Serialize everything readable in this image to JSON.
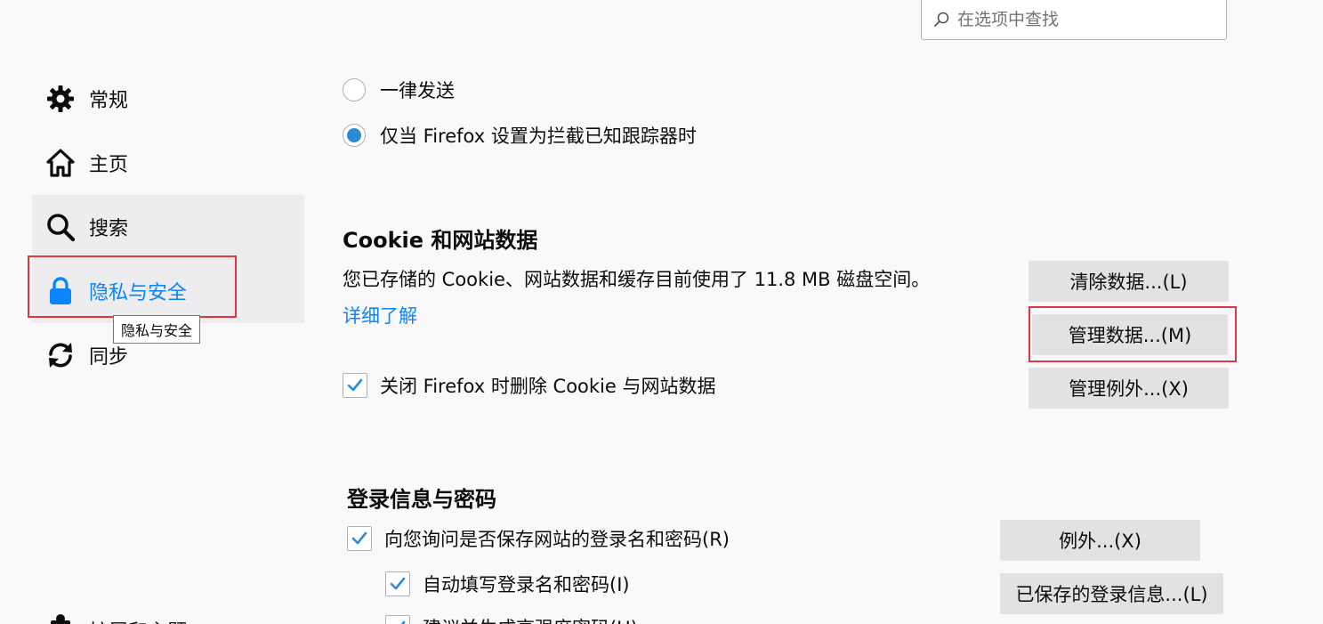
{
  "search": {
    "placeholder": "在选项中查找",
    "value": ""
  },
  "sidebar": {
    "items": [
      {
        "label": "常规",
        "icon": "gear-icon"
      },
      {
        "label": "主页",
        "icon": "home-icon"
      },
      {
        "label": "搜索",
        "icon": "search-icon",
        "state": "hovered"
      },
      {
        "label": "隐私与安全",
        "icon": "lock-icon",
        "state": "selected"
      },
      {
        "label": "同步",
        "icon": "sync-icon"
      },
      {
        "label": "扩展和主题",
        "icon": "puzzle-icon"
      }
    ],
    "tooltip": "隐私与安全"
  },
  "dnt": {
    "option_always": "一律发送",
    "option_tracking": "仅当 Firefox 设置为拦截已知跟踪器时",
    "selected": "option_tracking"
  },
  "cookies": {
    "title": "Cookie 和网站数据",
    "description": "您已存储的 Cookie、网站数据和缓存目前使用了 11.8 MB 磁盘空间。",
    "learn_more": "详细了解",
    "delete_on_close": {
      "label": "关闭 Firefox 时删除 Cookie 与网站数据",
      "checked": true
    },
    "buttons": {
      "clear": "清除数据...(L)",
      "manage": "管理数据...(M)",
      "exceptions": "管理例外...(X)"
    }
  },
  "logins": {
    "title": "登录信息与密码",
    "ask_save": {
      "label": "向您询问是否保存网站的登录名和密码(R)",
      "checked": true
    },
    "autofill": {
      "label": "自动填写登录名和密码(I)",
      "checked": true
    },
    "suggest": {
      "label": "建议并生成高强度密码(U)",
      "checked": true
    },
    "buttons": {
      "exceptions": "例外...(X)",
      "saved_logins": "已保存的登录信息...(L)"
    }
  },
  "colors": {
    "accent": "#0a84ff",
    "highlight": "#e0363c",
    "button_bg": "#e2e2e5",
    "check": "#2d8bd6"
  }
}
